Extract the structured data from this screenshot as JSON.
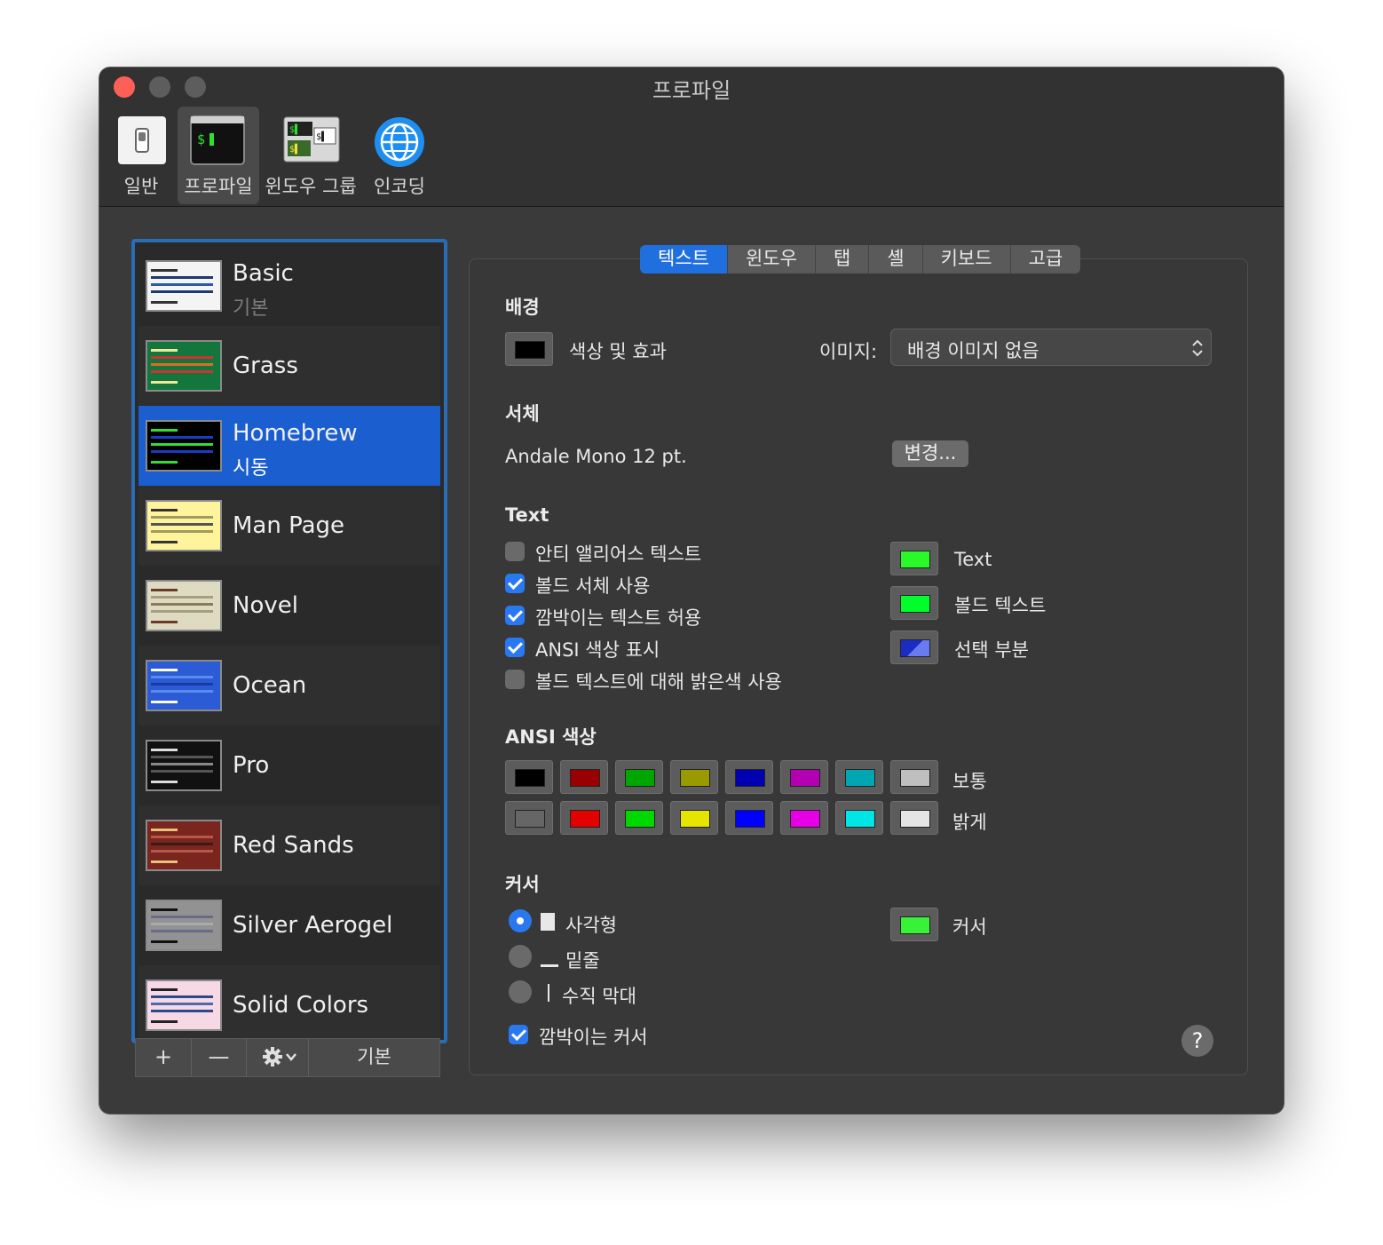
{
  "window": {
    "title": "프로파일"
  },
  "toolbar": [
    {
      "label": "일반"
    },
    {
      "label": "프로파일"
    },
    {
      "label": "윈도우 그룹"
    },
    {
      "label": "인코딩"
    }
  ],
  "profiles": [
    {
      "name": "Basic",
      "subtitle": "기본"
    },
    {
      "name": "Grass"
    },
    {
      "name": "Homebrew",
      "subtitle": "시동"
    },
    {
      "name": "Man Page"
    },
    {
      "name": "Novel"
    },
    {
      "name": "Ocean"
    },
    {
      "name": "Pro"
    },
    {
      "name": "Red Sands"
    },
    {
      "name": "Silver Aerogel"
    },
    {
      "name": "Solid Colors"
    }
  ],
  "list_toolbar": {
    "add": "+",
    "remove": "—",
    "default": "기본"
  },
  "tabs": [
    "텍스트",
    "윈도우",
    "탭",
    "셸",
    "키보드",
    "고급"
  ],
  "background": {
    "heading": "배경",
    "color_label": "색상 및 효과",
    "image_label": "이미지:",
    "image_value": "배경 이미지 없음"
  },
  "font": {
    "heading": "서체",
    "value": "Andale Mono 12 pt.",
    "change": "변경..."
  },
  "text": {
    "heading": "Text",
    "options": [
      {
        "label": "안티 앨리어스 텍스트",
        "checked": false
      },
      {
        "label": "볼드 서체 사용",
        "checked": true
      },
      {
        "label": "깜박이는 텍스트 허용",
        "checked": true
      },
      {
        "label": "ANSI 색상 표시",
        "checked": true
      },
      {
        "label": "볼드 텍스트에 대해 밝은색 사용",
        "checked": false
      }
    ],
    "colors": [
      {
        "label": "Text",
        "color": "#29f929"
      },
      {
        "label": "볼드 텍스트",
        "color": "#00ff2a"
      },
      {
        "label": "선택 부분",
        "color": "#1a2cc4"
      }
    ]
  },
  "ansi": {
    "heading": "ANSI 색상",
    "normal_label": "보통",
    "bright_label": "밝게",
    "normal": [
      "#000000",
      "#990000",
      "#00a600",
      "#999900",
      "#0000b2",
      "#b200b2",
      "#00a6b2",
      "#bfbfbf"
    ],
    "bright": [
      "#666666",
      "#e50000",
      "#00d900",
      "#e5e500",
      "#0000ff",
      "#e500e5",
      "#00e5e5",
      "#e5e5e5"
    ]
  },
  "cursor": {
    "heading": "커서",
    "styles": [
      {
        "label": "사각형",
        "selected": true
      },
      {
        "label": "밑줄",
        "selected": false
      },
      {
        "label": "수직 막대",
        "selected": false
      }
    ],
    "blink_label": "깜박이는 커서",
    "color_label": "커서",
    "color": "#38f238"
  },
  "help": "?"
}
